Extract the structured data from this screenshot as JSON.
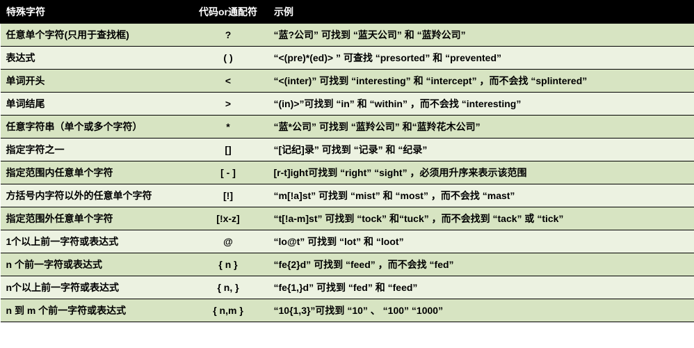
{
  "headers": {
    "special": "特殊字符",
    "code": "代码or通配符",
    "example": "示例"
  },
  "rows": [
    {
      "special": "任意单个字符(只用于查找框)",
      "code": "?",
      "example": "“蓝?公司” 可找到 “蓝天公司” 和 “蓝羚公司”"
    },
    {
      "special": "表达式",
      "code": "( )",
      "example": "“<(pre)*(ed)> ” 可查找 “presorted” 和 “prevented”"
    },
    {
      "special": "单词开头",
      "code": "<",
      "example": "“<(inter)” 可找到 “interesting” 和 “intercept” ，而不会找 “splintered”"
    },
    {
      "special": "单词结尾",
      "code": ">",
      "example": "“(in)>”可找到 “in” 和 “within” ，而不会找 “interesting”"
    },
    {
      "special": "任意字符串（单个或多个字符）",
      "code": "*",
      "example": "“蓝*公司” 可找到 “蓝羚公司” 和“蓝羚花木公司”"
    },
    {
      "special": "指定字符之一",
      "code": "[]",
      "example": "“[记纪]录” 可找到 “记录” 和 “纪录”"
    },
    {
      "special": "指定范围内任意单个字符",
      "code": "[ - ]",
      "example": "[r-t]ight可找到 “right” “sight” ，必须用升序来表示该范围"
    },
    {
      "special": "方括号内字符以外的任意单个字符",
      "code": "[!]",
      "example": "“m[!a]st” 可找到 “mist” 和 “most” ，而不会找 “mast”"
    },
    {
      "special": "指定范围外任意单个字符",
      "code": "[!x-z]",
      "example": "“t[!a-m]st” 可找到 “tock” 和“tuck” ，而不会找到 “tack” 或 “tick”"
    },
    {
      "special": "1个以上前一字符或表达式",
      "code": "@",
      "example": "“lo@t” 可找到 “lot” 和 “loot”"
    },
    {
      "special": "n 个前一字符或表达式",
      "code": "{ n }",
      "example": "“fe{2}d” 可找到 “feed” ，而不会找 “fed”"
    },
    {
      "special": "n个以上前一字符或表达式",
      "code": "{ n, }",
      "example": "“fe{1,}d” 可找到 “fed” 和 “feed”"
    },
    {
      "special": "n 到 m 个前一字符或表达式",
      "code": "{ n,m }",
      "example": "“10{1,3}”可找到 “10” 、 “100” “1000”"
    }
  ]
}
